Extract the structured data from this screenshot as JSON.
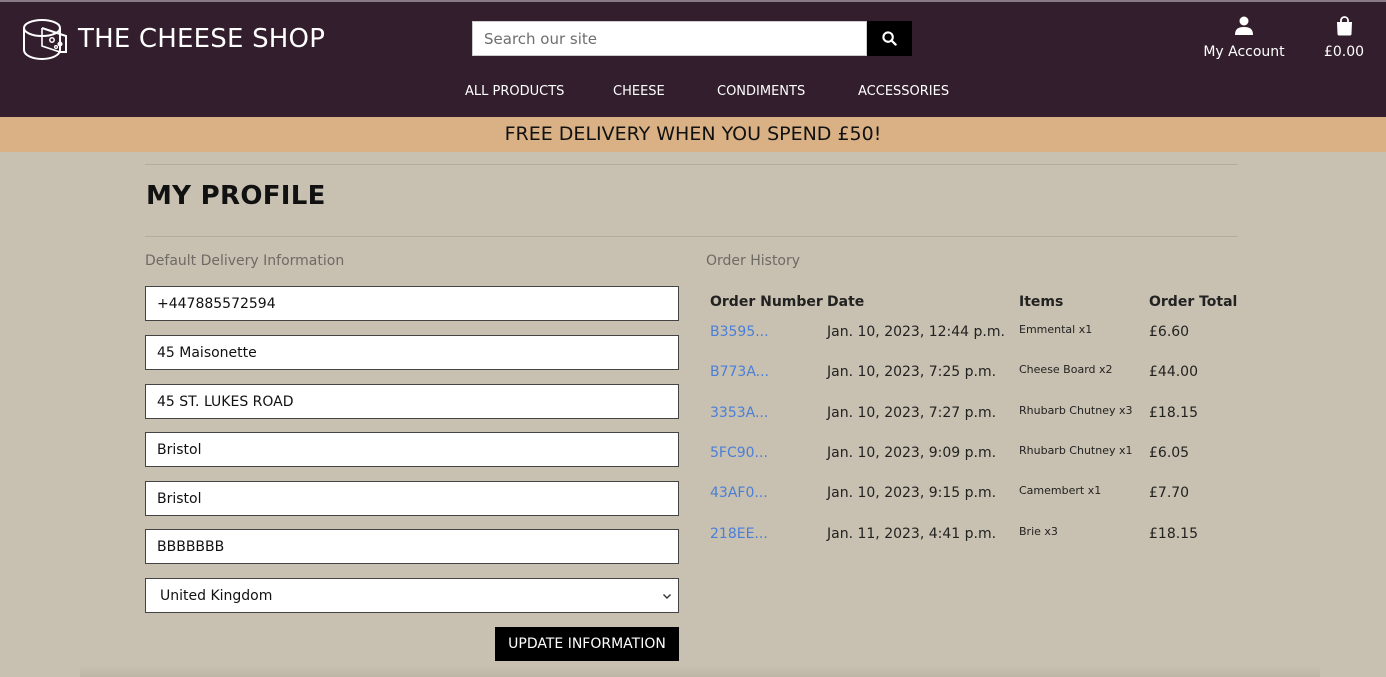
{
  "header": {
    "logo_text": "THE CHEESE SHOP",
    "search_placeholder": "Search our site",
    "account_label": "My Account",
    "bag_total": "£0.00"
  },
  "nav": {
    "items": [
      "ALL PRODUCTS",
      "CHEESE",
      "CONDIMENTS",
      "ACCESSORIES"
    ]
  },
  "banner": "FREE DELIVERY WHEN YOU SPEND £50!",
  "page_title": "MY PROFILE",
  "delivery": {
    "heading": "Default Delivery Information",
    "phone": "+447885572594",
    "street1": "45 Maisonette",
    "street2": "45 ST. LUKES ROAD",
    "town": "Bristol",
    "county": "Bristol",
    "postcode": "BBBBBBB",
    "country": "United Kingdom",
    "update_label": "UPDATE INFORMATION"
  },
  "orders": {
    "heading": "Order History",
    "columns": [
      "Order Number",
      "Date",
      "Items",
      "Order Total"
    ],
    "rows": [
      {
        "number": "B3595...",
        "date": "Jan. 10, 2023, 12:44 p.m.",
        "items": "Emmental x1",
        "total": "£6.60"
      },
      {
        "number": "B773A...",
        "date": "Jan. 10, 2023, 7:25 p.m.",
        "items": "Cheese Board x2",
        "total": "£44.00"
      },
      {
        "number": "3353A...",
        "date": "Jan. 10, 2023, 7:27 p.m.",
        "items": "Rhubarb Chutney x3",
        "total": "£18.15"
      },
      {
        "number": "5FC90...",
        "date": "Jan. 10, 2023, 9:09 p.m.",
        "items": "Rhubarb Chutney x1",
        "total": "£6.05"
      },
      {
        "number": "43AF0...",
        "date": "Jan. 10, 2023, 9:15 p.m.",
        "items": "Camembert x1",
        "total": "£7.70"
      },
      {
        "number": "218EE...",
        "date": "Jan. 11, 2023, 4:41 p.m.",
        "items": "Brie x3",
        "total": "£18.15"
      }
    ]
  },
  "colors": {
    "header_bg": "#331e2d",
    "banner_bg": "#d9b184",
    "page_bg": "#c8c0b0",
    "link": "#4a7fd8"
  }
}
